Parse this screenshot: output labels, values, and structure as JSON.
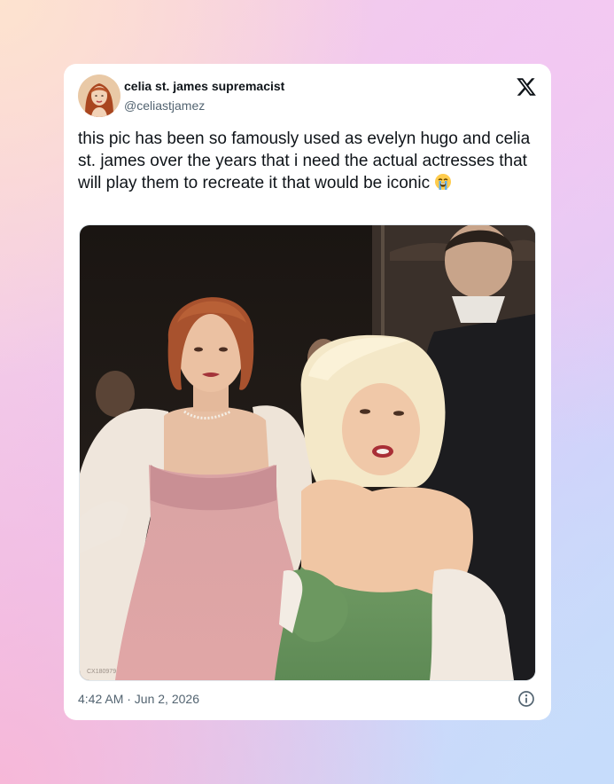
{
  "tweet": {
    "display_name": "celia st. james supremacist",
    "handle": "@celiastjamez",
    "text": "this pic has been so famously used as evelyn hugo and celia st. james over the years that i need the actual actresses that will play them to recreate it that would be iconic",
    "emoji": "loudly-crying-face",
    "timestamp": "4:42 AM · Jun 2, 2026"
  },
  "icons": {
    "platform_logo": "x-logo-icon",
    "info": "info-icon",
    "avatar": "avatar"
  },
  "colors": {
    "card_background": "#ffffff",
    "primary_text": "#0f1419",
    "secondary_text": "#536471"
  }
}
